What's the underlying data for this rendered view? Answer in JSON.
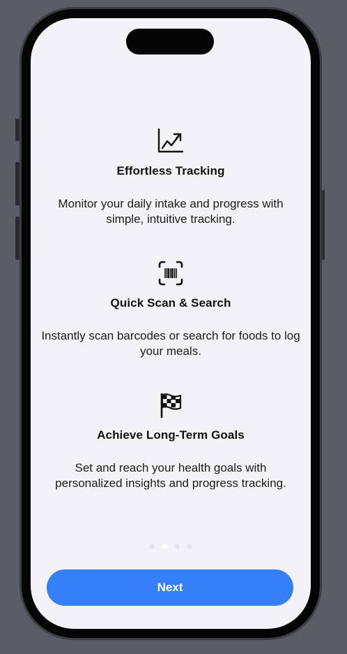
{
  "onboarding": {
    "features": [
      {
        "icon": "chart-line-uptrend-icon",
        "title": "Effortless Tracking",
        "description": "Monitor your daily intake and progress with simple, intuitive tracking."
      },
      {
        "icon": "barcode-viewfinder-icon",
        "title": "Quick Scan & Search",
        "description": "Instantly scan barcodes or search for foods to log your meals."
      },
      {
        "icon": "flag-checkered-icon",
        "title": "Achieve Long-Term Goals",
        "description": "Set and reach your health goals with personalized insights and progress tracking."
      }
    ],
    "page_indicator": {
      "count": 4,
      "current_index": 1
    },
    "next_label": "Next"
  },
  "colors": {
    "accent": "#3580f6",
    "screen_background": "#f2f2f7",
    "device_background": "#5a5d63"
  }
}
